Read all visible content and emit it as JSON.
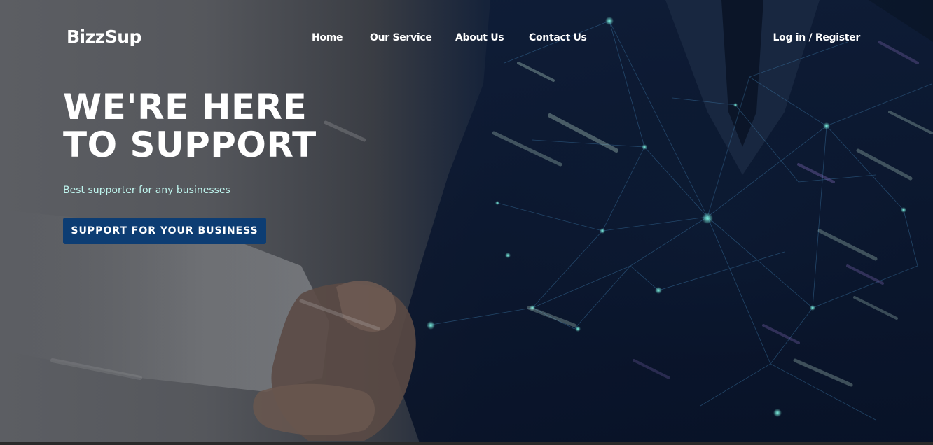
{
  "brand": {
    "name": "BizzSup"
  },
  "nav": {
    "home": "Home",
    "service": "Our Service",
    "about": "About Us",
    "contact": "Contact Us",
    "auth": "Log in / Register"
  },
  "hero": {
    "headline": "WE'RE HERE TO SUPPORT",
    "subtitle": "Best supporter for any businesses",
    "cta_label": "SUPPORT FOR YOUR BUSINESS",
    "background_image": "businessman-handshake-with-digital-network-globe"
  },
  "colors": {
    "cta_background": "#0d3d73",
    "subtitle_text": "#bff5ee",
    "text_primary": "#ffffff"
  }
}
